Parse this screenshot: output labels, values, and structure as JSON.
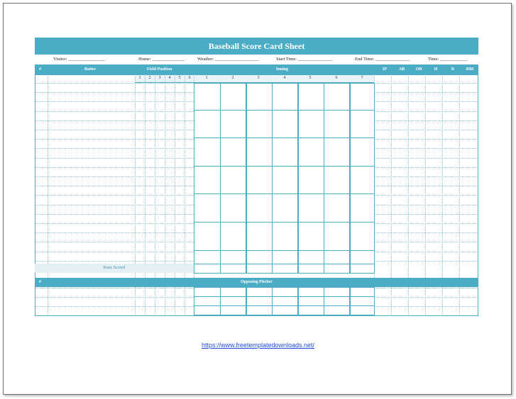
{
  "title": "Baseball Score Card Sheet",
  "info": {
    "visitor": "Visitor: ________________",
    "home": "Home: ______________",
    "weather": "Weather: ___________________",
    "start_time": "Start Time: _______________",
    "end_time": "End Time: _______________",
    "time": "Time: ____________"
  },
  "headers": {
    "num": "#",
    "batter": "Batter",
    "field_position": "Field Position",
    "inning": "Inning",
    "stats": [
      "IP",
      "AB",
      "OB",
      "H",
      "R",
      "RBI"
    ]
  },
  "field_positions": [
    "1",
    "2",
    "3",
    "4",
    "5",
    "6"
  ],
  "innings": [
    "1",
    "2",
    "3",
    "4",
    "5",
    "6",
    "7"
  ],
  "runs_scored": "Runs Scored",
  "opposing": {
    "num": "#",
    "label": "Opposing Pitcher"
  },
  "link": "https://www.freetemplatedownloads.net/"
}
